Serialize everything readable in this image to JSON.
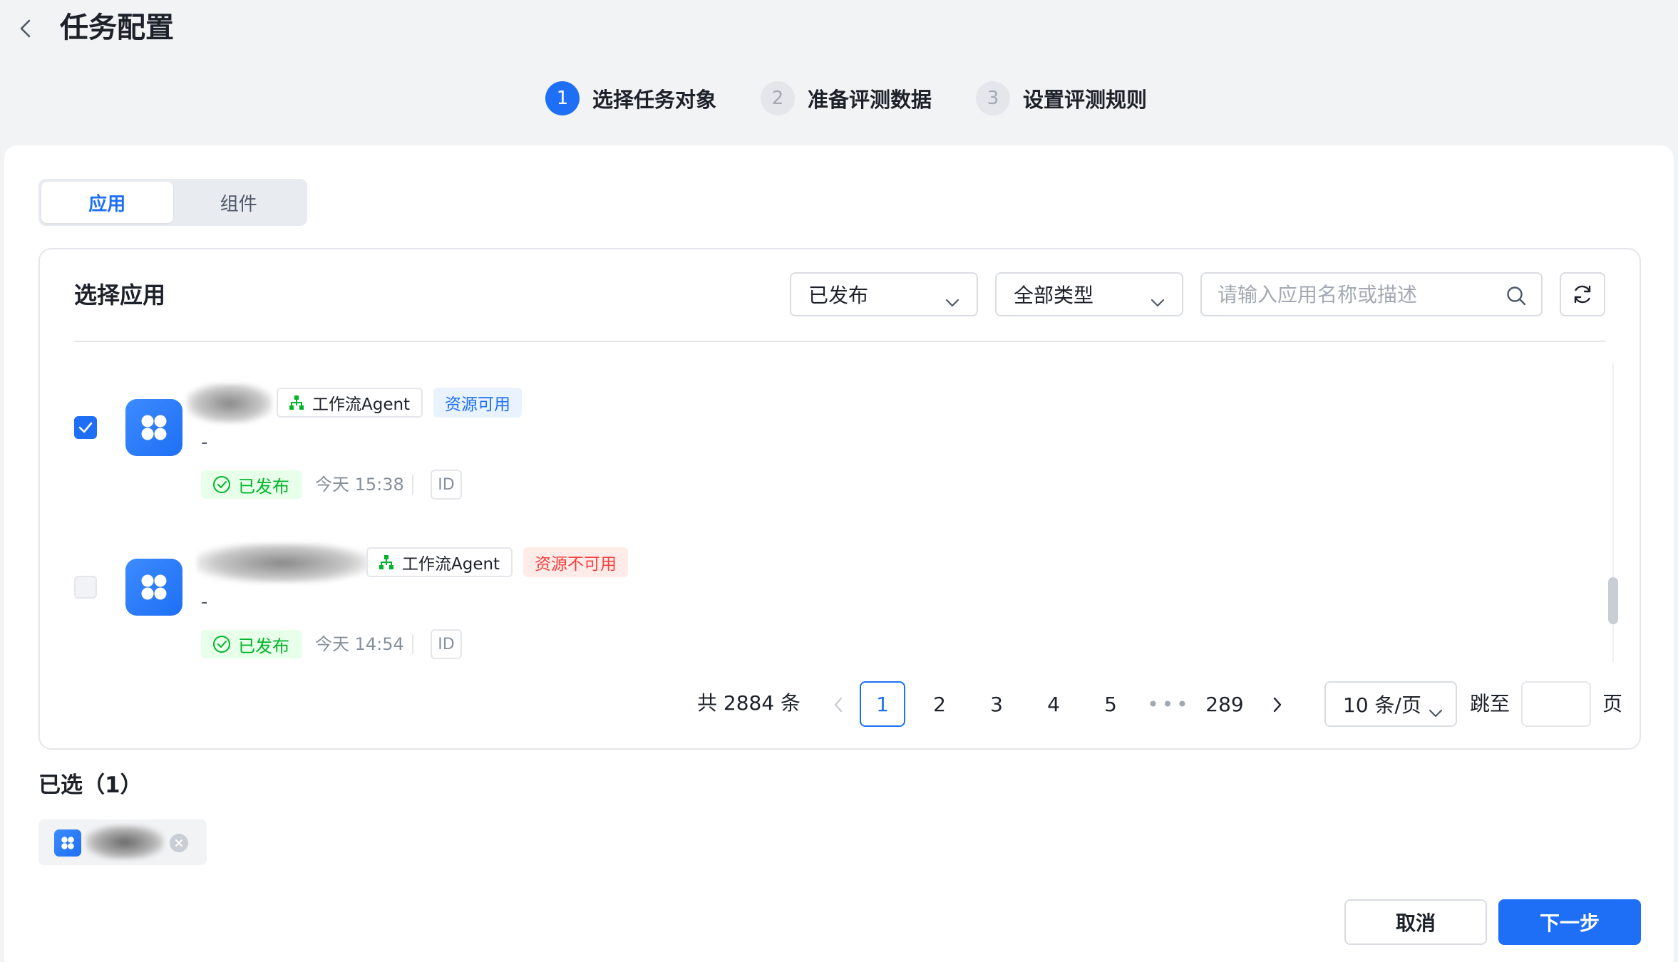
{
  "header": {
    "title": "任务配置"
  },
  "steps": [
    {
      "number": "1",
      "label": "选择任务对象",
      "state": "active"
    },
    {
      "number": "2",
      "label": "准备评测数据",
      "state": "pending"
    },
    {
      "number": "3",
      "label": "设置评测规则",
      "state": "pending"
    }
  ],
  "tabs": [
    {
      "label": "应用",
      "active": true
    },
    {
      "label": "组件",
      "active": false
    }
  ],
  "panel": {
    "title": "选择应用",
    "status_filter": "已发布",
    "type_filter": "全部类型",
    "search_placeholder": "请输入应用名称或描述"
  },
  "apps": [
    {
      "checked": true,
      "agent_tag": "工作流Agent",
      "availability": "资源可用",
      "description": "-",
      "status": "已发布",
      "time": "今天 15:38",
      "id_label": "ID"
    },
    {
      "checked": false,
      "agent_tag": "工作流Agent",
      "availability": "资源不可用",
      "description": "-",
      "status": "已发布",
      "time": "今天 14:54",
      "id_label": "ID"
    }
  ],
  "pagination": {
    "total": "共 2884 条",
    "pages": [
      "1",
      "2",
      "3",
      "4",
      "5"
    ],
    "ellipsis": "•••",
    "last_page": "289",
    "current": "1",
    "page_size": "10 条/页",
    "jump_label": "跳至",
    "jump_suffix": "页"
  },
  "selected": {
    "title": "已选（1）"
  },
  "footer": {
    "cancel": "取消",
    "next": "下一步"
  },
  "colors": {
    "primary": "#1e6ff5",
    "success": "#00b42a",
    "danger": "#f53f3f",
    "background": "#f2f3f5"
  }
}
